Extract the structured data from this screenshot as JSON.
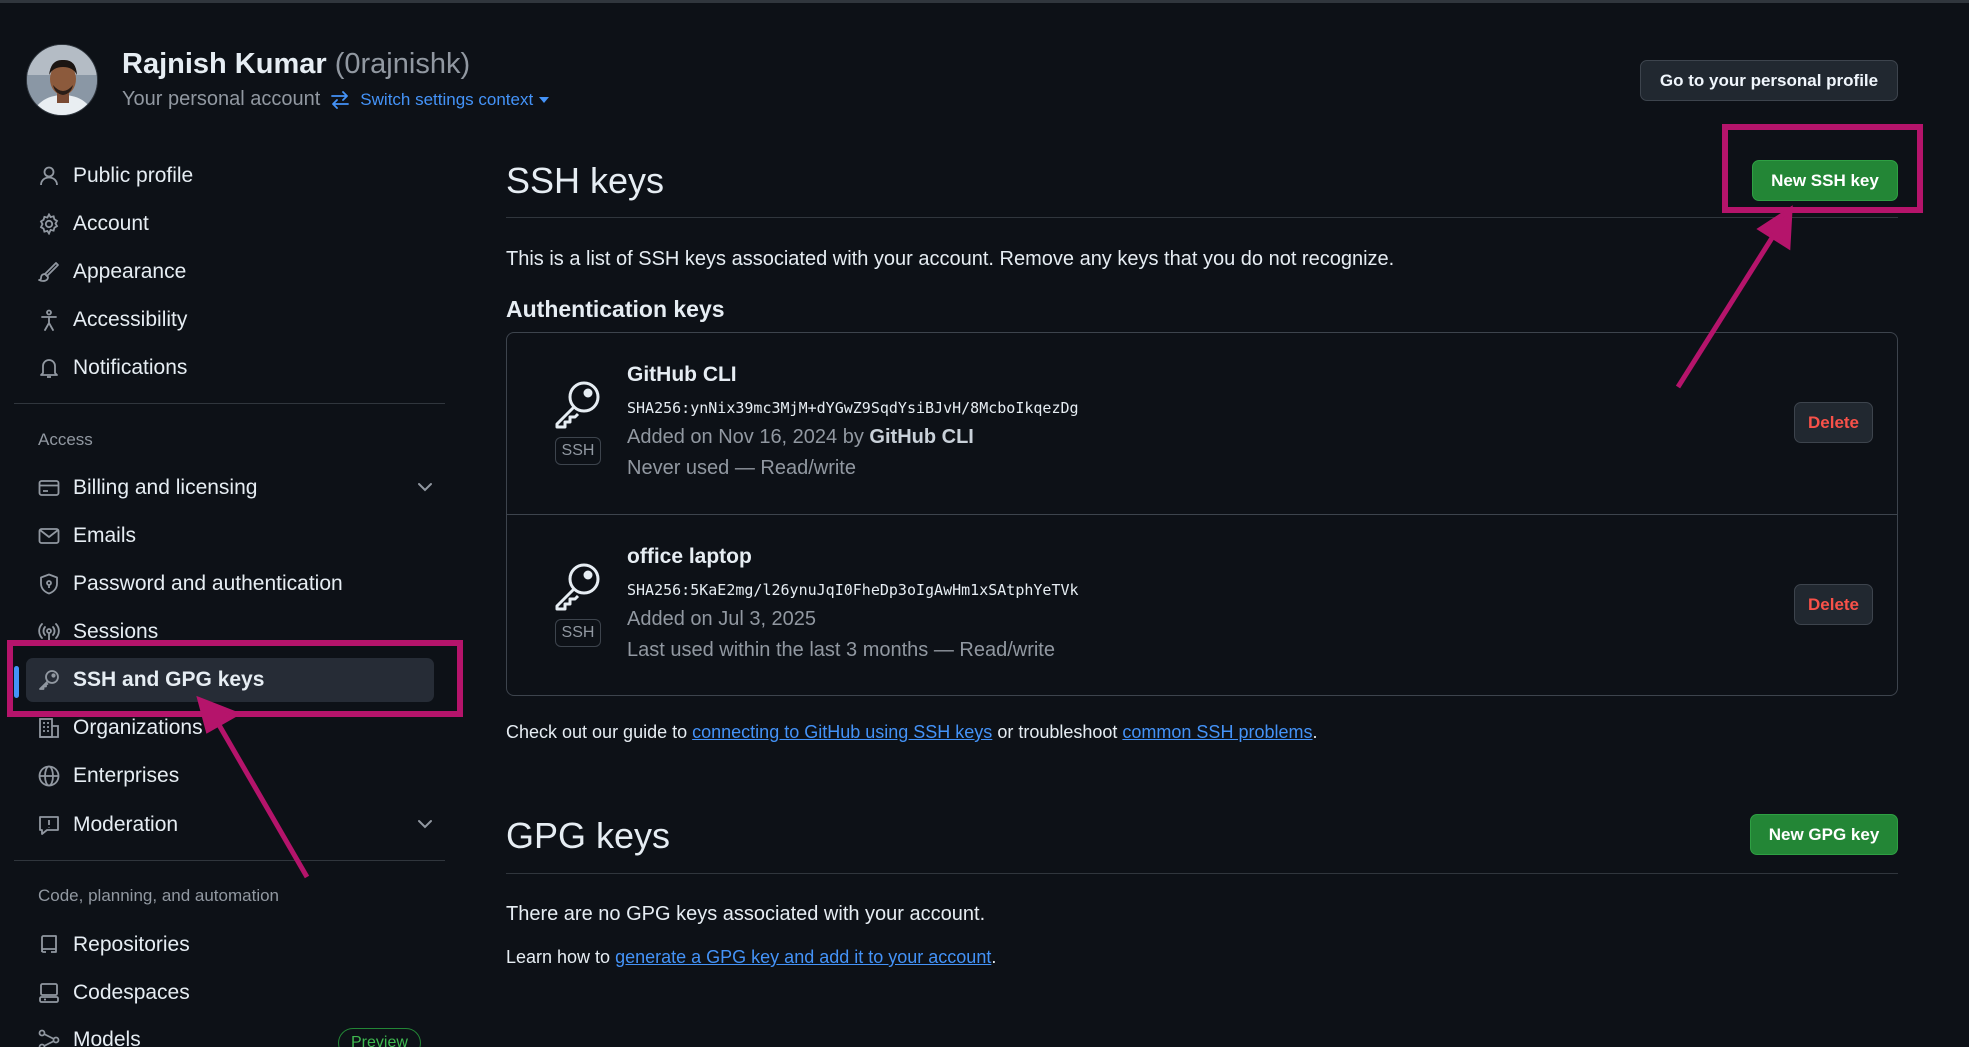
{
  "header": {
    "name": "Rajnish Kumar",
    "login": "(0rajnishk)",
    "subtitle": "Your personal account",
    "switch_label": "Switch settings context",
    "profile_button": "Go to your personal profile"
  },
  "sidebar": {
    "items": [
      {
        "label": "Public profile",
        "icon": "person-icon"
      },
      {
        "label": "Account",
        "icon": "gear-icon"
      },
      {
        "label": "Appearance",
        "icon": "paintbrush-icon"
      },
      {
        "label": "Accessibility",
        "icon": "accessibility-icon"
      },
      {
        "label": "Notifications",
        "icon": "bell-icon"
      }
    ],
    "access_heading": "Access",
    "access_items": [
      {
        "label": "Billing and licensing",
        "icon": "credit-card-icon"
      },
      {
        "label": "Emails",
        "icon": "mail-icon"
      },
      {
        "label": "Password and authentication",
        "icon": "shield-lock-icon"
      },
      {
        "label": "Sessions",
        "icon": "broadcast-icon"
      },
      {
        "label": "SSH and GPG keys",
        "icon": "key-icon"
      },
      {
        "label": "Organizations",
        "icon": "organization-icon"
      },
      {
        "label": "Enterprises",
        "icon": "globe-icon"
      },
      {
        "label": "Moderation",
        "icon": "report-icon"
      }
    ],
    "code_heading": "Code, planning, and automation",
    "code_items": [
      {
        "label": "Repositories",
        "icon": "repo-icon"
      },
      {
        "label": "Codespaces",
        "icon": "codespaces-icon"
      },
      {
        "label": "Models",
        "icon": "models-icon"
      }
    ],
    "preview_badge": "Preview"
  },
  "ssh": {
    "title": "SSH keys",
    "new_button": "New SSH key",
    "description": "This is a list of SSH keys associated with your account. Remove any keys that you do not recognize.",
    "auth_heading": "Authentication keys",
    "keys": [
      {
        "title": "GitHub CLI",
        "fingerprint": "SHA256:ynNix39mc3MjM+dYGwZ9SqdYsiBJvH/8McboIkqezDg",
        "added_prefix": "Added on Nov 16, 2024 by",
        "added_by": "GitHub CLI",
        "usage": "Never used — Read/write",
        "type_label": "SSH",
        "delete_label": "Delete"
      },
      {
        "title": "office laptop",
        "fingerprint": "SHA256:5KaE2mg/l26ynuJqI0FheDp3oIgAwHm1xSAtphYeTVk",
        "added_prefix": "Added on Jul 3, 2025",
        "added_by": "",
        "usage": "Last used within the last 3 months — Read/write",
        "type_label": "SSH",
        "delete_label": "Delete"
      }
    ],
    "guide_prefix": "Check out our guide to",
    "guide_link": "connecting to GitHub using SSH keys",
    "guide_middle": "or troubleshoot",
    "guide_link2": "common SSH problems",
    "guide_suffix": "."
  },
  "gpg": {
    "title": "GPG keys",
    "new_button": "New GPG key",
    "empty_text": "There are no GPG keys associated with your account.",
    "learn_prefix": "Learn how to",
    "learn_link": "generate a GPG key and add it to your account",
    "learn_suffix": "."
  },
  "colors": {
    "annotation": "#b5146b",
    "accent": "#4493f8",
    "green": "#238636",
    "danger": "#f85149"
  }
}
